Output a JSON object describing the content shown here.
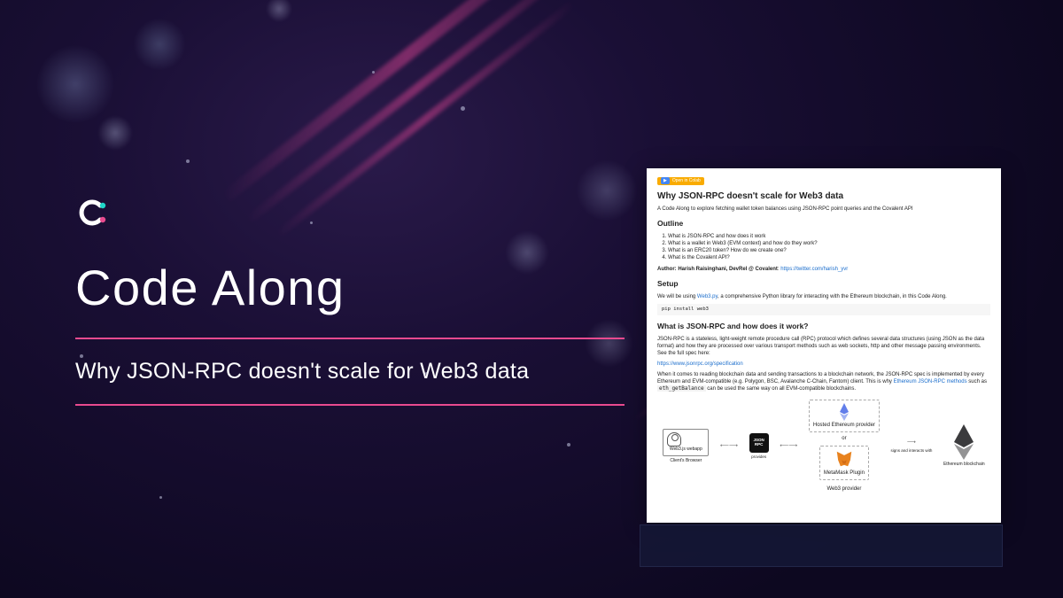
{
  "hero": {
    "title": "Code Along",
    "subtitle": "Why JSON-RPC doesn't scale for Web3 data"
  },
  "doc": {
    "badge": "Open in Colab",
    "h1": "Why JSON-RPC doesn't scale for Web3 data",
    "intro": "A Code Along to explore fetching wallet token balances using JSON-RPC point queries and the Covalent API",
    "outline_h": "Outline",
    "outline": [
      "What is JSON-RPC and how does it work",
      "What is a wallet in Web3 (EVM context) and how do they work?",
      "What is an ERC20 token? How do we create one?",
      "What is the Covalent API?"
    ],
    "author_label": "Author: Harish Raisinghani, DevRel @ Covalent",
    "author_link": "https://twitter.com/harish_yvr",
    "setup_h": "Setup",
    "setup_p1": "We will be using ",
    "setup_lib": "Web3.py",
    "setup_p2": ", a comprehensive Python library for interacting with the Ethereum blockchain, in this Code Along.",
    "setup_code": "pip install web3",
    "what_h": "What is JSON-RPC and how does it work?",
    "what_p1": "JSON-RPC is a stateless, light-weight remote procedure call (RPC) protocol which defines several data structures (using JSON as the data format) and how they are processed over various transport methods such as web sockets, http and other message passing environments. See the full spec here:",
    "spec_link": "https://www.jsonrpc.org/specification",
    "what_p2a": "When it comes to reading blockchain data and sending transactions to a blockchain network, the JSON-RPC spec is implemented by every Ethereum and EVM-compatible (e.g. Polygon, BSC, Avalanche C-Chain, Fantom) client. This is why ",
    "what_link2": "Ethereum JSON-RPC methods",
    "what_p2b": " such as ",
    "what_code": "eth_getBalance",
    "what_p2c": " can be used the same way on all EVM-compatible blockchains.",
    "diagram": {
      "webapp": "Web3.js webapp",
      "browser": "Client's Browser",
      "provides": "provides",
      "json_rpc": "JSON RPC",
      "hosted": "Hosted Ethereum provider",
      "or": "or",
      "metamask": "MetaMask Plugin",
      "web3prov": "Web3 provider",
      "signs": "signs and interacts with",
      "eth": "Ethereum blockchain"
    }
  }
}
